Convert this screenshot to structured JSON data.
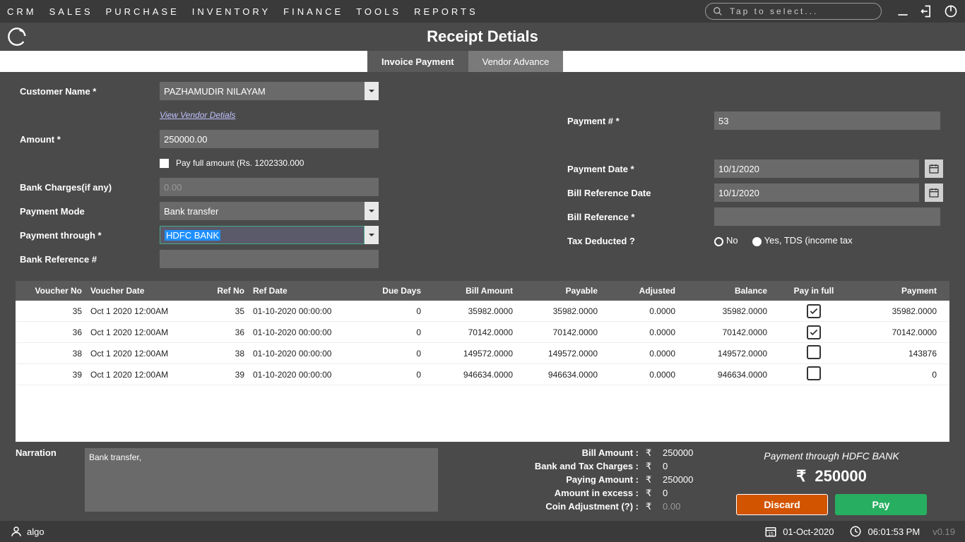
{
  "topmenu": [
    "CRM",
    "SALES",
    "PURCHASE",
    "INVENTORY",
    "FINANCE",
    "TOOLS",
    "REPORTS"
  ],
  "search_placeholder": "Tap to select...",
  "page_title": "Receipt Detials",
  "tabs": {
    "invoice": "Invoice Payment",
    "advance": "Vendor Advance"
  },
  "form": {
    "customer_label": "Customer Name *",
    "customer_value": "PAZHAMUDIR NILAYAM",
    "view_vendor": "View Vendor Detials",
    "amount_label": "Amount *",
    "amount_value": "250000.00",
    "pay_full_label": "Pay full amount (Rs. 1202330.000",
    "bank_charges_label": "Bank Charges(if any)",
    "bank_charges_value": "0.00",
    "payment_mode_label": "Payment Mode",
    "payment_mode_value": "Bank transfer",
    "payment_through_label": "Payment through *",
    "payment_through_value": "HDFC BANK",
    "bank_ref_label": "Bank Reference #",
    "bank_ref_value": "",
    "payment_no_label": "Payment # *",
    "payment_no_value": "53",
    "payment_date_label": "Payment Date *",
    "payment_date_value": "10/1/2020",
    "bill_ref_date_label": "Bill Reference Date",
    "bill_ref_date_value": "10/1/2020",
    "bill_ref_label": "Bill Reference *",
    "bill_ref_value": "",
    "tax_label": "Tax Deducted ?",
    "tax_no": "No",
    "tax_yes": "Yes, TDS (income tax"
  },
  "table": {
    "headers": [
      "Voucher No",
      "Voucher Date",
      "Ref No",
      "Ref Date",
      "Due Days",
      "Bill Amount",
      "Payable",
      "Adjusted",
      "Balance",
      "Pay in full",
      "Payment"
    ],
    "rows": [
      {
        "vno": "35",
        "vdate": "Oct  1 2020 12:00AM",
        "refno": "35",
        "refdate": "01-10-2020 00:00:00",
        "due": "0",
        "bill": "35982.0000",
        "pay": "35982.0000",
        "adj": "0.0000",
        "bal": "35982.0000",
        "pif": true,
        "pmt": "35982.0000"
      },
      {
        "vno": "36",
        "vdate": "Oct  1 2020 12:00AM",
        "refno": "36",
        "refdate": "01-10-2020 00:00:00",
        "due": "0",
        "bill": "70142.0000",
        "pay": "70142.0000",
        "adj": "0.0000",
        "bal": "70142.0000",
        "pif": true,
        "pmt": "70142.0000"
      },
      {
        "vno": "38",
        "vdate": "Oct  1 2020 12:00AM",
        "refno": "38",
        "refdate": "01-10-2020 00:00:00",
        "due": "0",
        "bill": "149572.0000",
        "pay": "149572.0000",
        "adj": "0.0000",
        "bal": "149572.0000",
        "pif": false,
        "pmt": "143876"
      },
      {
        "vno": "39",
        "vdate": "Oct  1 2020 12:00AM",
        "refno": "39",
        "refdate": "01-10-2020 00:00:00",
        "due": "0",
        "bill": "946634.0000",
        "pay": "946634.0000",
        "adj": "0.0000",
        "bal": "946634.0000",
        "pif": false,
        "pmt": "0"
      }
    ]
  },
  "narration": {
    "label": "Narration",
    "value": "Bank transfer,"
  },
  "summary": {
    "bill_amount_lbl": "Bill Amount  :",
    "bill_amount_val": "250000",
    "bank_tax_lbl": "Bank and Tax Charges  :",
    "bank_tax_val": "0",
    "paying_lbl": "Paying Amount  :",
    "paying_val": "250000",
    "excess_lbl": "Amount in excess  :",
    "excess_val": "0",
    "coin_lbl": "Coin Adjustment (?)  :",
    "coin_val": "0.00"
  },
  "pay_panel": {
    "through": "Payment through HDFC BANK",
    "amount": "250000",
    "discard": "Discard",
    "pay": "Pay"
  },
  "status": {
    "user": "algo",
    "date": "01-Oct-2020",
    "time": "06:01:53 PM",
    "version": "v0.19"
  }
}
